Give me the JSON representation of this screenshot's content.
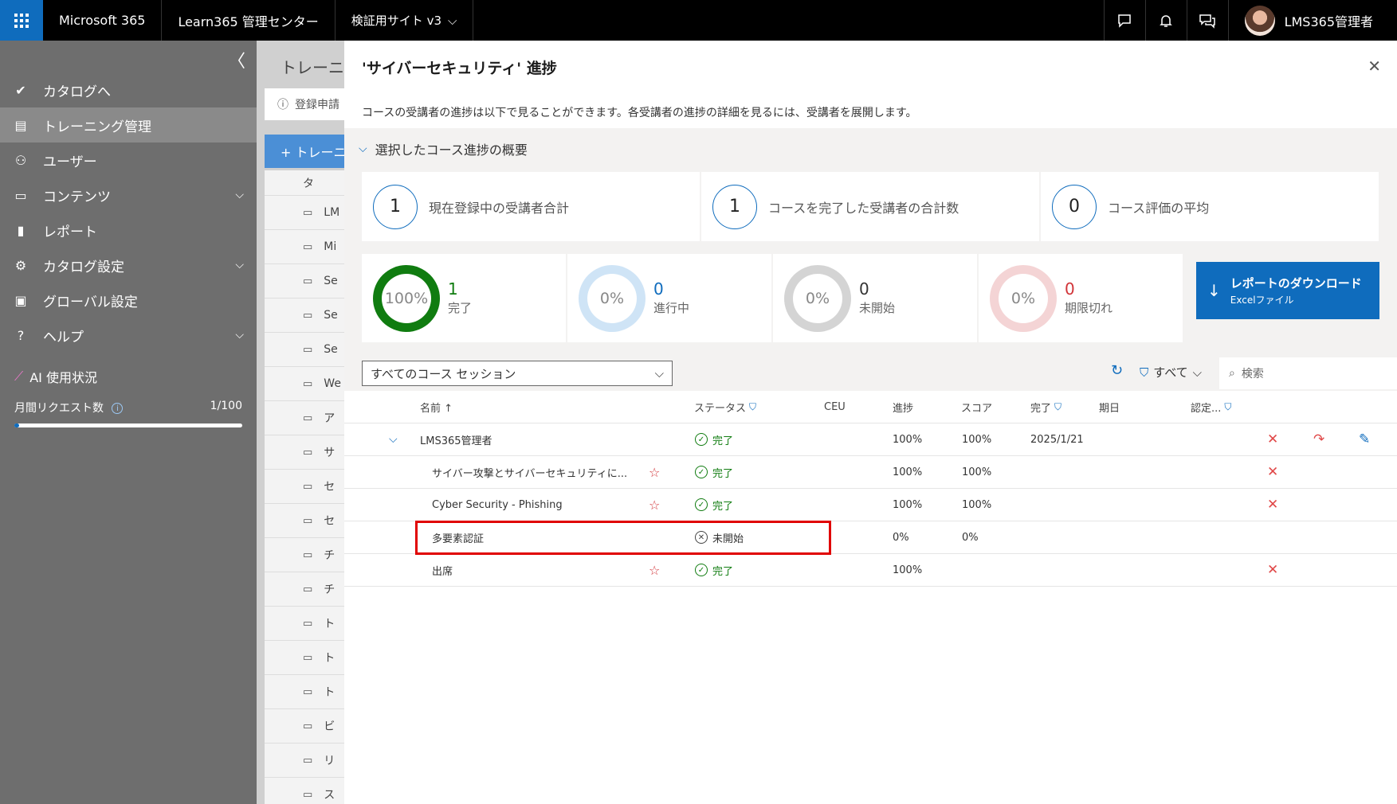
{
  "topbar": {
    "app": "Microsoft 365",
    "admin_center": "Learn365 管理センター",
    "site": "検証用サイト v3",
    "user_name": "LMS365管理者"
  },
  "nav": {
    "items": [
      {
        "label": "カタログへ",
        "icon": "check-circle-icon"
      },
      {
        "label": "トレーニング管理",
        "icon": "training-icon"
      },
      {
        "label": "ユーザー",
        "icon": "users-icon"
      },
      {
        "label": "コンテンツ",
        "icon": "folder-icon"
      },
      {
        "label": "レポート",
        "icon": "chart-icon"
      },
      {
        "label": "カタログ設定",
        "icon": "gear-icon"
      },
      {
        "label": "グローバル設定",
        "icon": "global-settings-icon"
      },
      {
        "label": "ヘルプ",
        "icon": "help-icon"
      }
    ],
    "ai_title": "AI 使用状況",
    "monthly_label": "月間リクエスト数",
    "monthly_value": "1/100",
    "monthly_fraction": 0.01
  },
  "bgpage": {
    "title": "トレーニ",
    "info": "登録申請",
    "add_btn": "+ トレーニ",
    "header": "タ",
    "rows": [
      "LM",
      "Mi",
      "Se",
      "Se",
      "Se",
      "We",
      "ア",
      "サ",
      "セ",
      "セ",
      "チ",
      "チ",
      "ト",
      "ト",
      "ト",
      "ビ",
      "リ",
      "ス"
    ]
  },
  "panel": {
    "title": "'サイバーセキュリティ' 進捗",
    "description": "コースの受講者の進捗は以下で見ることができます。各受講者の進捗の詳細を見るには、受講者を展開します。",
    "summary_toggle": "選択したコース進捗の概要",
    "stats": [
      {
        "value": "1",
        "label": "現在登録中の受講者合計"
      },
      {
        "value": "1",
        "label": "コースを完了した受講者の合計数"
      },
      {
        "value": "0",
        "label": "コース評価の平均"
      }
    ],
    "donuts": [
      {
        "pct": "100%",
        "count": "1",
        "label": "完了",
        "color": "#107c10",
        "track": "#107c10",
        "fraction": 1
      },
      {
        "pct": "0%",
        "count": "0",
        "label": "進行中",
        "color": "#0f6cbd",
        "track": "#cfe4f6",
        "fraction": 0
      },
      {
        "pct": "0%",
        "count": "0",
        "label": "未開始",
        "color": "#333333",
        "track": "#d4d4d4",
        "fraction": 0
      },
      {
        "pct": "0%",
        "count": "0",
        "label": "期限切れ",
        "color": "#d13438",
        "track": "#f4d4d5",
        "fraction": 0
      }
    ],
    "download_title": "レポートのダウンロード",
    "download_sub": "Excelファイル",
    "session_select": "すべてのコース セッション",
    "filter_all": "すべて",
    "search_placeholder": "検索"
  },
  "table": {
    "headers": {
      "name": "名前 ↑",
      "status": "ステータス",
      "ceu": "CEU",
      "progress": "進捗",
      "score": "スコア",
      "completed": "完了",
      "due": "期日",
      "cert": "認定..."
    },
    "rows": [
      {
        "name": "LMS365管理者",
        "status": "完了",
        "progress": "100%",
        "score": "100%",
        "completed": "2025/1/21",
        "star": false
      },
      {
        "name": "サイバー攻撃とサイバーセキュリティに...",
        "status": "完了",
        "progress": "100%",
        "score": "100%",
        "completed": "",
        "star": true
      },
      {
        "name": "Cyber Security - Phishing",
        "status": "完了",
        "progress": "100%",
        "score": "100%",
        "completed": "",
        "star": true
      },
      {
        "name": "多要素認証",
        "status": "未開始",
        "progress": "0%",
        "score": "0%",
        "completed": "",
        "star": false
      },
      {
        "name": "出席",
        "status": "完了",
        "progress": "100%",
        "score": "",
        "completed": "",
        "star": true
      }
    ]
  }
}
